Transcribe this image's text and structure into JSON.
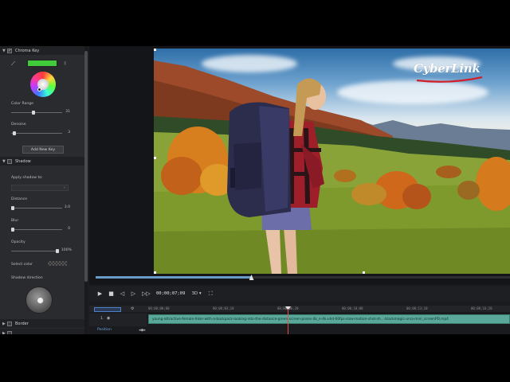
{
  "effects_panel": {
    "chroma_key": {
      "title": "Chroma Key",
      "enabled": true,
      "key_color": "#3fcb3a",
      "dropper_icon": "eyedropper-icon",
      "delete_icon": "trash-icon",
      "color_range_label": "Color Range",
      "color_range_value": "31",
      "color_range_fraction": 0.31,
      "denoise_label": "Denoise",
      "denoise_value": "3",
      "denoise_fraction": 0.03,
      "add_key_label": "Add New Key"
    },
    "shadow": {
      "title": "Shadow",
      "enabled": false,
      "apply_shadow_to_label": "Apply shadow to:",
      "apply_shadow_to_value": "",
      "distance_label": "Distance",
      "distance_value": "3.0",
      "distance_fraction": 0.0,
      "blur_label": "Blur",
      "blur_value": "0",
      "blur_fraction": 0.0,
      "opacity_label": "Opacity",
      "opacity_value": "100%",
      "opacity_fraction": 1.0,
      "select_color_label": "Select color",
      "shadow_direction_label": "Shadow direction"
    },
    "border": {
      "title": "Border",
      "enabled": false
    }
  },
  "preview": {
    "logo_text": "CyberLink",
    "playback_fraction": 0.376
  },
  "transport": {
    "timecode": "00;00;07;09",
    "mode_label": "3D",
    "mode_chevron": "▾"
  },
  "timeline": {
    "ruler_ticks": [
      "00;00;00;00",
      "00;00;03;10",
      "00;00;06;20",
      "00;00;10;00",
      "00;00;13;10",
      "00;00;16;20"
    ],
    "track_number": "1.",
    "clip_name": "young-attractive-female-hiker-with-a-backpack-looking-into-the-distance-green-screen-poses-4k_e-4k-uhd-60fps-slow-motion-shot-sh...-blackmagic-ursa-mini_screenPD.mp4",
    "position_label": "Position"
  }
}
